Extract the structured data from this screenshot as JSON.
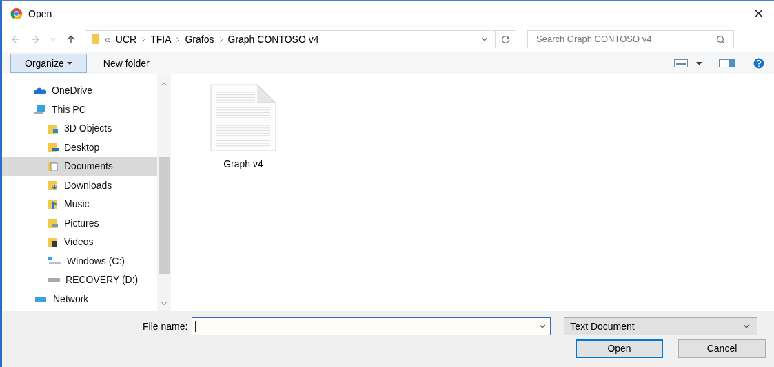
{
  "window": {
    "title": "Open",
    "close": "×"
  },
  "nav": {
    "breadcrumb_prefix": "«",
    "breadcrumb": [
      "UCR",
      "TFIA",
      "Grafos",
      "Graph CONTOSO v4"
    ],
    "search": {
      "placeholder": "Search Graph CONTOSO v4"
    }
  },
  "toolbar": {
    "organize": "Organize",
    "new_folder": "New folder"
  },
  "sidebar": {
    "items": [
      {
        "label": "OneDrive",
        "selected": false
      },
      {
        "label": "This PC",
        "selected": false,
        "children": [
          {
            "label": "3D Objects",
            "selected": false
          },
          {
            "label": "Desktop",
            "selected": false
          },
          {
            "label": "Documents",
            "selected": true
          },
          {
            "label": "Downloads",
            "selected": false
          },
          {
            "label": "Music",
            "selected": false
          },
          {
            "label": "Pictures",
            "selected": false
          },
          {
            "label": "Videos",
            "selected": false
          },
          {
            "label": "Windows (C:)",
            "selected": false
          },
          {
            "label": "RECOVERY (D:)",
            "selected": false
          }
        ]
      },
      {
        "label": "Network",
        "selected": false
      }
    ]
  },
  "files": [
    {
      "name": "Graph v4",
      "kind": "text"
    }
  ],
  "footer": {
    "file_name_label": "File name:",
    "file_type": "Text Document",
    "open": "Open",
    "cancel": "Cancel"
  }
}
